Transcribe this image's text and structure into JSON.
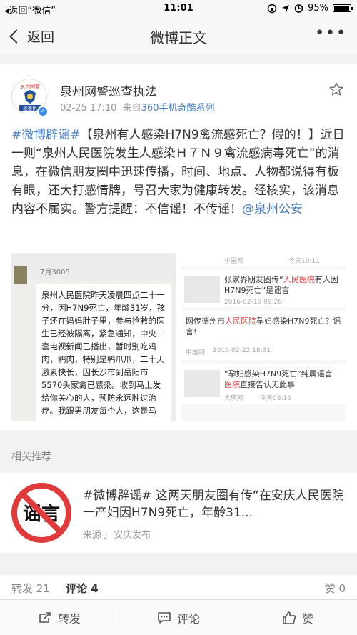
{
  "status_bar": {
    "back_app": "◂返回“微信”",
    "time": "11:01",
    "battery": "95%",
    "battery_level": 0.95
  },
  "nav": {
    "back_label": "返回",
    "title": "微博正文",
    "more": "•••"
  },
  "post": {
    "author": "泉州网警巡查执法",
    "date": "02-25 17:10",
    "source_prefix": "来自",
    "source": "360手机奇酷系列",
    "hashtag": "#微博辟谣#",
    "body": "【泉州有人感染H7N9禽流感死亡？假的！】近日一则“泉州人民医院发生人感染Ｈ７Ｎ９禽流感病毒死亡”的消息，在微信朋友圈中迅速传播，时间、地点、人物都说得有板有眼，还大打感情牌，号召大家为健康转发。经核实，该消息内容不属实。警方提醒：不信谣！不传谣！",
    "mention": "@泉州公安",
    "avatar_text": "泉州网警\n巡查执",
    "images": {
      "chat": {
        "date": "7月3005",
        "message": "泉州人民医院昨天凌晨四点二十一分，因H7N9死亡，年龄31岁，孩子还在妈妈肚子里，参与抢救的医生已经被隔离，紧急通知，中央二套电视新闻已播出，暂时别吃鸡肉，鸭肉，特别是鸭爪爪，二十天激素快长，因长沙市到岳阳市5570头家禽已感染。收到马上发给你关心的人，预防永远胜过治疗。我跟男朋友每个人，这是马"
      },
      "news": [
        {
          "title_a": "",
          "red": "",
          "title_b": "",
          "src": "中国网",
          "time": "今天10:11"
        },
        {
          "title_a": "张家界朋友圈传“",
          "red": "人民医院",
          "title_b": "有人因H7N9死亡”是谣言",
          "src": "",
          "time": "2016-02-19 09:28"
        },
        {
          "title_a": "网传德州市",
          "red": "人民医院",
          "title_b": "孕妇感染H7N9死亡？谣言!",
          "src": "中国网",
          "time": "2016-02-22 18:31"
        },
        {
          "title_a": "“孕妇感染H7N9死亡”纯属谣言 ",
          "red": "医院",
          "title_b": "直接告认无此事",
          "src": "大庆网",
          "time": "今天08:16"
        }
      ]
    }
  },
  "related": {
    "label": "相关推荐",
    "logo_text": "谣言",
    "text": "#微博辟谣# 这两天朋友圈有传“在安庆人民医院一产妇因H7N9死亡，年龄31...",
    "source": "来源于 安庆发布"
  },
  "counts": {
    "repost": "转发 21",
    "comment": "评论 4",
    "like": "赞 0"
  },
  "actions": {
    "repost": "转发",
    "comment": "评论",
    "like": "赞"
  },
  "colors": {
    "link": "#4a7fc1",
    "verified": "#3b8ee8",
    "rumor_red": "#e03a3a"
  }
}
